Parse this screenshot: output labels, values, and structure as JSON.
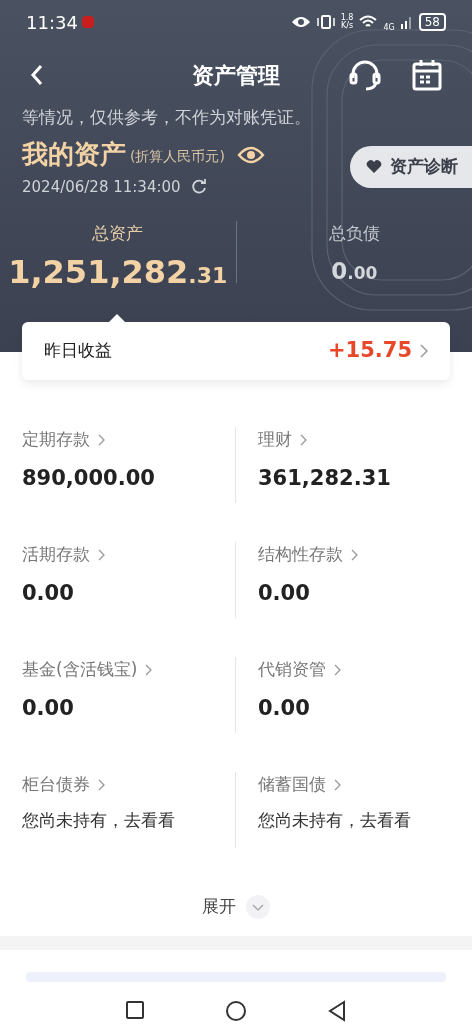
{
  "status_bar": {
    "time": "11:34",
    "network_speed": "1.8\nK/s",
    "network_type": "4G",
    "battery": "58"
  },
  "nav": {
    "title": "资产管理"
  },
  "notice": "等情况，仅供参考，不作为对账凭证。",
  "summary": {
    "title": "我的资产",
    "currency_note": "(折算人民币元)",
    "timestamp": "2024/06/28 11:34:00",
    "diagnosis_button": "资产诊断",
    "totals": [
      {
        "label": "总资产",
        "integer": "1,251,282",
        "decimal": ".31",
        "selected": true
      },
      {
        "label": "总负债",
        "integer": "0",
        "decimal": ".00",
        "selected": false
      }
    ]
  },
  "yesterday": {
    "label": "昨日收益",
    "value": "+15.75"
  },
  "holdings": [
    {
      "label": "定期存款",
      "value": "890,000.00",
      "kind": "amount"
    },
    {
      "label": "理财",
      "value": "361,282.31",
      "kind": "amount"
    },
    {
      "label": "活期存款",
      "value": "0.00",
      "kind": "amount"
    },
    {
      "label": "结构性存款",
      "value": "0.00",
      "kind": "amount"
    },
    {
      "label": "基金(含活钱宝)",
      "value": "0.00",
      "kind": "amount"
    },
    {
      "label": "代销资管",
      "value": "0.00",
      "kind": "amount"
    },
    {
      "label": "柜台债券",
      "value": "您尚未持有，去看看",
      "kind": "note"
    },
    {
      "label": "储蓄国债",
      "value": "您尚未持有，去看看",
      "kind": "note"
    }
  ],
  "expand_button": "展开"
}
